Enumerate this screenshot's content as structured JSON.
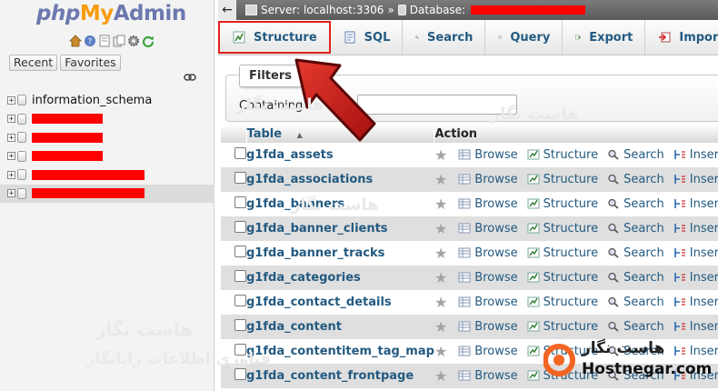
{
  "left_panel": {
    "logo": {
      "php": "php",
      "my": "My",
      "admin": "Admin"
    },
    "nav_icons": [
      "home-icon",
      "info-icon",
      "docs-icon",
      "copy-icon",
      "settings-icon",
      "reload-icon"
    ],
    "tabs": [
      {
        "label": "Recent"
      },
      {
        "label": "Favorites"
      }
    ],
    "databases": [
      {
        "name": "information_schema",
        "redacted": false,
        "redact_width": 0
      },
      {
        "name": "",
        "redacted": true,
        "redact_width": 78
      },
      {
        "name": "",
        "redacted": true,
        "redact_width": 78
      },
      {
        "name": "",
        "redacted": true,
        "redact_width": 78
      },
      {
        "name": "",
        "redacted": true,
        "redact_width": 124
      },
      {
        "name": "",
        "redacted": true,
        "redact_width": 124
      }
    ]
  },
  "breadcrumb": {
    "server": "Server: localhost:3306",
    "separator": "»",
    "database": "Database:"
  },
  "menu_tabs": [
    {
      "label": "Structure",
      "icon": "structure-icon",
      "active": true
    },
    {
      "label": "SQL",
      "icon": "sql-icon"
    },
    {
      "label": "Search",
      "icon": "search-icon"
    },
    {
      "label": "Query",
      "icon": "query-icon"
    },
    {
      "label": "Export",
      "icon": "export-icon"
    },
    {
      "label": "Import",
      "icon": "import-icon"
    }
  ],
  "filters": {
    "legend": "Filters",
    "containing_label": "Containing",
    "input_value": ""
  },
  "table": {
    "columns": [
      "Table",
      "Action"
    ],
    "sort_indicator": "▲",
    "actions": [
      "Browse",
      "Structure",
      "Search",
      "Insert"
    ],
    "rows": [
      "g1fda_assets",
      "g1fda_associations",
      "g1fda_banners",
      "g1fda_banner_clients",
      "g1fda_banner_tracks",
      "g1fda_categories",
      "g1fda_contact_details",
      "g1fda_content",
      "g1fda_contentitem_tag_map",
      "g1fda_content_frontpage"
    ]
  },
  "watermark": {
    "fa": "هاست نگار",
    "fa_sub": "فناوری اطلاعات رایانگار",
    "en": "Hostnegar.com"
  },
  "colors": {
    "link": "#235a81",
    "highlight_border": "#e2201c",
    "redaction": "#ff0000",
    "arrow": "#c4161c"
  }
}
